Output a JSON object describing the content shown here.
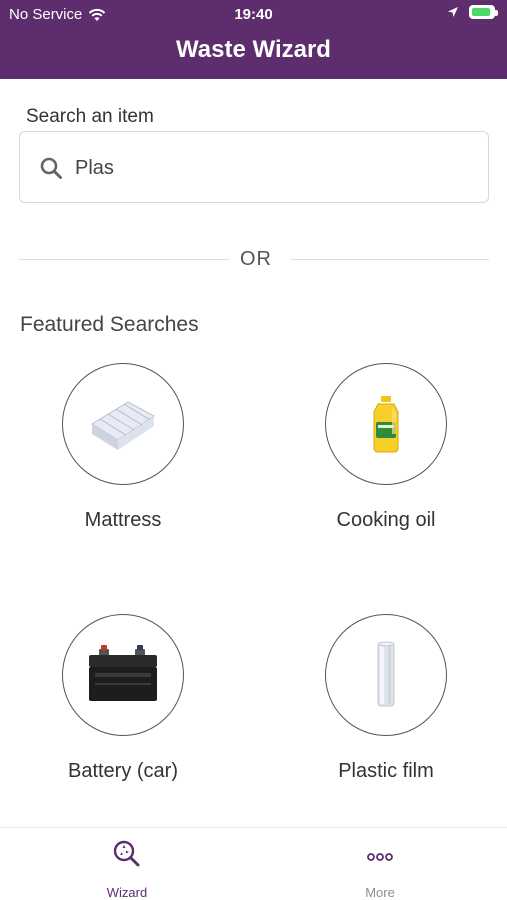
{
  "status_bar": {
    "carrier": "No Service",
    "time": "19:40"
  },
  "header": {
    "title": "Waste Wizard"
  },
  "search": {
    "label": "Search an item",
    "value": "Plas"
  },
  "divider": {
    "text": "OR"
  },
  "featured": {
    "title": "Featured Searches",
    "items": [
      {
        "label": "Mattress",
        "icon": "mattress-icon"
      },
      {
        "label": "Cooking oil",
        "icon": "cooking-oil-icon"
      },
      {
        "label": "Battery (car)",
        "icon": "car-battery-icon"
      },
      {
        "label": "Plastic film",
        "icon": "plastic-film-icon"
      }
    ]
  },
  "tab_bar": {
    "tabs": [
      {
        "label": "Wizard",
        "active": true,
        "icon": "wizard-search-icon"
      },
      {
        "label": "More",
        "active": false,
        "icon": "more-icon"
      }
    ]
  },
  "colors": {
    "brand": "#5e2d6e",
    "active_tab": "#5e2d6e",
    "inactive_tab": "#8e8e93"
  }
}
